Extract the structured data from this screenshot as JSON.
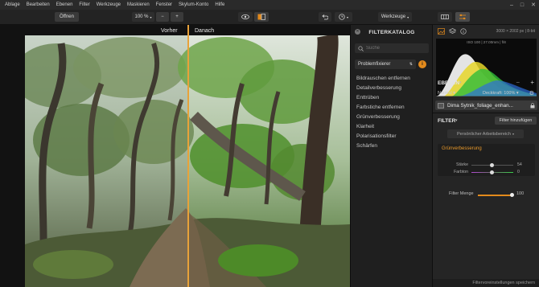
{
  "menu": [
    "Ablage",
    "Bearbeiten",
    "Ebenen",
    "Filter",
    "Werkzeuge",
    "Maskieren",
    "Fenster",
    "Skylum-Konto",
    "Hilfe"
  ],
  "window_controls": {
    "minimize": "–",
    "maximize": "□",
    "close": "✕"
  },
  "toolbar": {
    "open_label": "Öffnen",
    "zoom_value": "100 %",
    "zoom_out": "−",
    "zoom_in": "+",
    "tools_label": "Werkzeuge"
  },
  "canvas": {
    "before_label": "Vorher",
    "after_label": "Danach"
  },
  "catalog": {
    "title": "FILTERKATALOG",
    "close": "✕",
    "search_placeholder": "Suche",
    "category": "Problemfixierer",
    "info": "i",
    "filters": [
      "Bildrauschen entfernen",
      "Detailverbesserung",
      "Enttrüben",
      "Farbstiche entfernen",
      "Grünverbesserung",
      "Klarheit",
      "Polarisationsfilter",
      "Schärfen"
    ]
  },
  "right_panel": {
    "image_size": "3000 × 2002 px",
    "bit_depth": "8-bit",
    "exif": "ISO 100 | 27.00mm | f/8",
    "layers_title": "EBENEN",
    "blend_mode": "Normal",
    "opacity_label": "Deckkraft: 100%",
    "layer_name": "Dima Sytnik_foliage_enhan...",
    "filter_title": "FILTER",
    "add_filter_label": "Filter hinzufügen",
    "workspace": "Persönlicher Arbeitsbereich",
    "active_filter": {
      "name": "Grünverbesserung",
      "sliders": [
        {
          "label": "Stärke",
          "value": "54"
        },
        {
          "label": "Farbton",
          "value": "0"
        }
      ]
    },
    "filter_amount_label": "Filter Menge",
    "filter_amount_value": "100",
    "save_preset": "Filtervoreinstellungen speichern"
  },
  "colors": {
    "accent": "#e38a1c",
    "panel": "#252525",
    "divider": "#e8a23a"
  }
}
